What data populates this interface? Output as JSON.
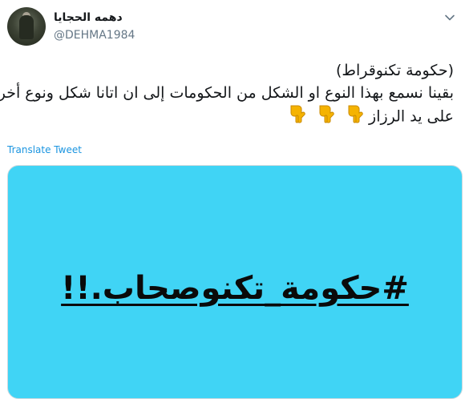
{
  "tweet": {
    "display_name": "دهمه الحجايا",
    "handle": "@DEHMA1984",
    "lines": [
      "(حكومة تكنوقراط)",
      "بقينا نسمع بهذا النوع او الشكل من الحكومات  إلى ان اتانا شكل ونوع أخر",
      "على يد الرزاز"
    ],
    "emoji": [
      "pointing-down-emoji",
      "pointing-down-emoji",
      "pointing-down-emoji"
    ],
    "translate_label": "Translate Tweet",
    "image_text": "#حكومة_تكنوصحاب.!!",
    "colors": {
      "image_background": "#40d4f5",
      "link": "#1b95e0",
      "handle": "#657786",
      "emoji": "#f5b301"
    }
  }
}
